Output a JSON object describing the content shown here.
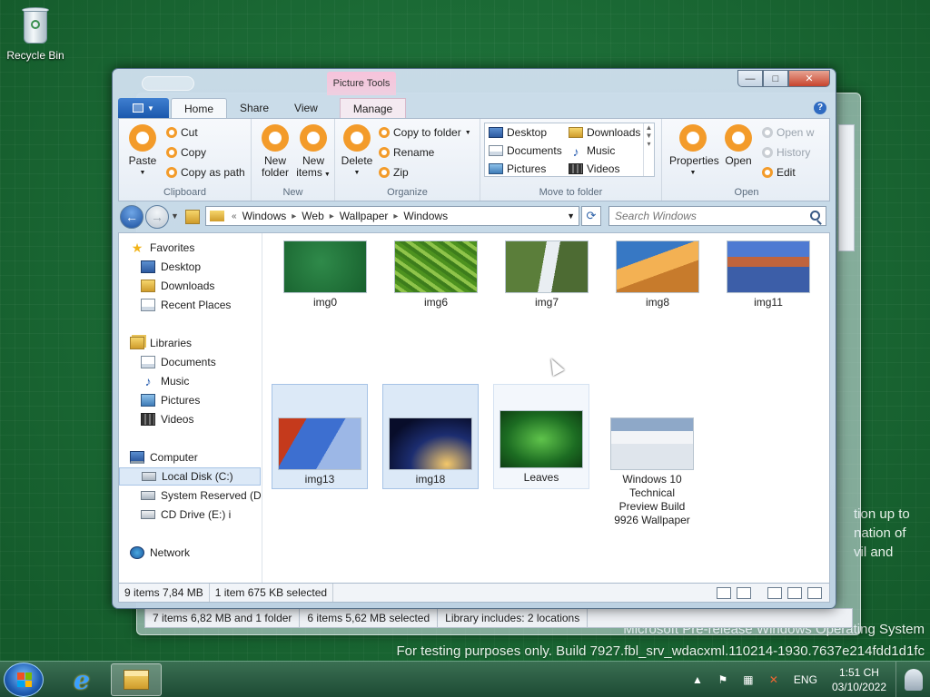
{
  "desktop": {
    "recycle_bin_label": "Recycle Bin",
    "watermark_side_lines": [
      "tion up to",
      "nation of",
      "vil and"
    ],
    "watermark_line1": "Microsoft Pre-release Windows Operating System",
    "watermark_line2": "For testing purposes only. Build 7927.fbl_srv_wdacxml.110214-1930.7637e214fdd1d1fc"
  },
  "back_window": {
    "status_items": "7 items 6,82 MB and 1 folder",
    "status_selected": "6 items 5,62 MB selected",
    "status_library": "Library includes:  2 locations"
  },
  "window": {
    "contextual_tab_group": "Picture Tools",
    "tabs": {
      "home": "Home",
      "share": "Share",
      "view": "View",
      "manage": "Manage"
    },
    "help_glyph": "?",
    "controls": {
      "minimize": "—",
      "maximize": "□",
      "close": "✕"
    }
  },
  "ribbon": {
    "clipboard": {
      "label": "Clipboard",
      "paste": "Paste",
      "cut": "Cut",
      "copy": "Copy",
      "copy_as_path": "Copy as path"
    },
    "new": {
      "label": "New",
      "new_folder_l1": "New",
      "new_folder_l2": "folder",
      "new_items_l1": "New",
      "new_items_l2": "items"
    },
    "organize": {
      "label": "Organize",
      "delete": "Delete",
      "copy_to_folder": "Copy to folder",
      "rename": "Rename",
      "zip": "Zip"
    },
    "move_to_folder": {
      "label": "Move to folder",
      "items": [
        "Desktop",
        "Downloads",
        "Documents",
        "Music",
        "Pictures",
        "Videos"
      ]
    },
    "open": {
      "label": "Open",
      "properties": "Properties",
      "open": "Open",
      "open_with": "Open w",
      "history": "History",
      "edit": "Edit"
    }
  },
  "address_bar": {
    "overflow": "«",
    "crumbs": [
      "Windows",
      "Web",
      "Wallpaper",
      "Windows"
    ],
    "search_placeholder": "Search Windows"
  },
  "nav_pane": {
    "favorites": "Favorites",
    "favorites_items": [
      "Desktop",
      "Downloads",
      "Recent Places"
    ],
    "libraries": "Libraries",
    "libraries_items": [
      "Documents",
      "Music",
      "Pictures",
      "Videos"
    ],
    "computer": "Computer",
    "computer_items": [
      "Local Disk (C:)",
      "System Reserved (D:",
      "CD Drive (E:) i"
    ],
    "network": "Network"
  },
  "files": [
    {
      "name": "img0",
      "selected": false
    },
    {
      "name": "img6",
      "selected": false
    },
    {
      "name": "img7",
      "selected": false
    },
    {
      "name": "img8",
      "selected": false
    },
    {
      "name": "img11",
      "selected": false
    },
    {
      "name": "img13",
      "selected": true
    },
    {
      "name": "img18",
      "selected": true
    },
    {
      "name": "Leaves",
      "selected": false,
      "hovered": true
    },
    {
      "name_lines": [
        "Windows 10",
        "Technical",
        "Preview Build",
        "9926 Wallpaper"
      ],
      "selected": false
    }
  ],
  "status_bar": {
    "items": "9 items 7,84 MB",
    "selected": "1 item 675 KB selected"
  },
  "taskbar": {
    "language": "ENG",
    "time": "1:51 CH",
    "date": "03/10/2022"
  }
}
